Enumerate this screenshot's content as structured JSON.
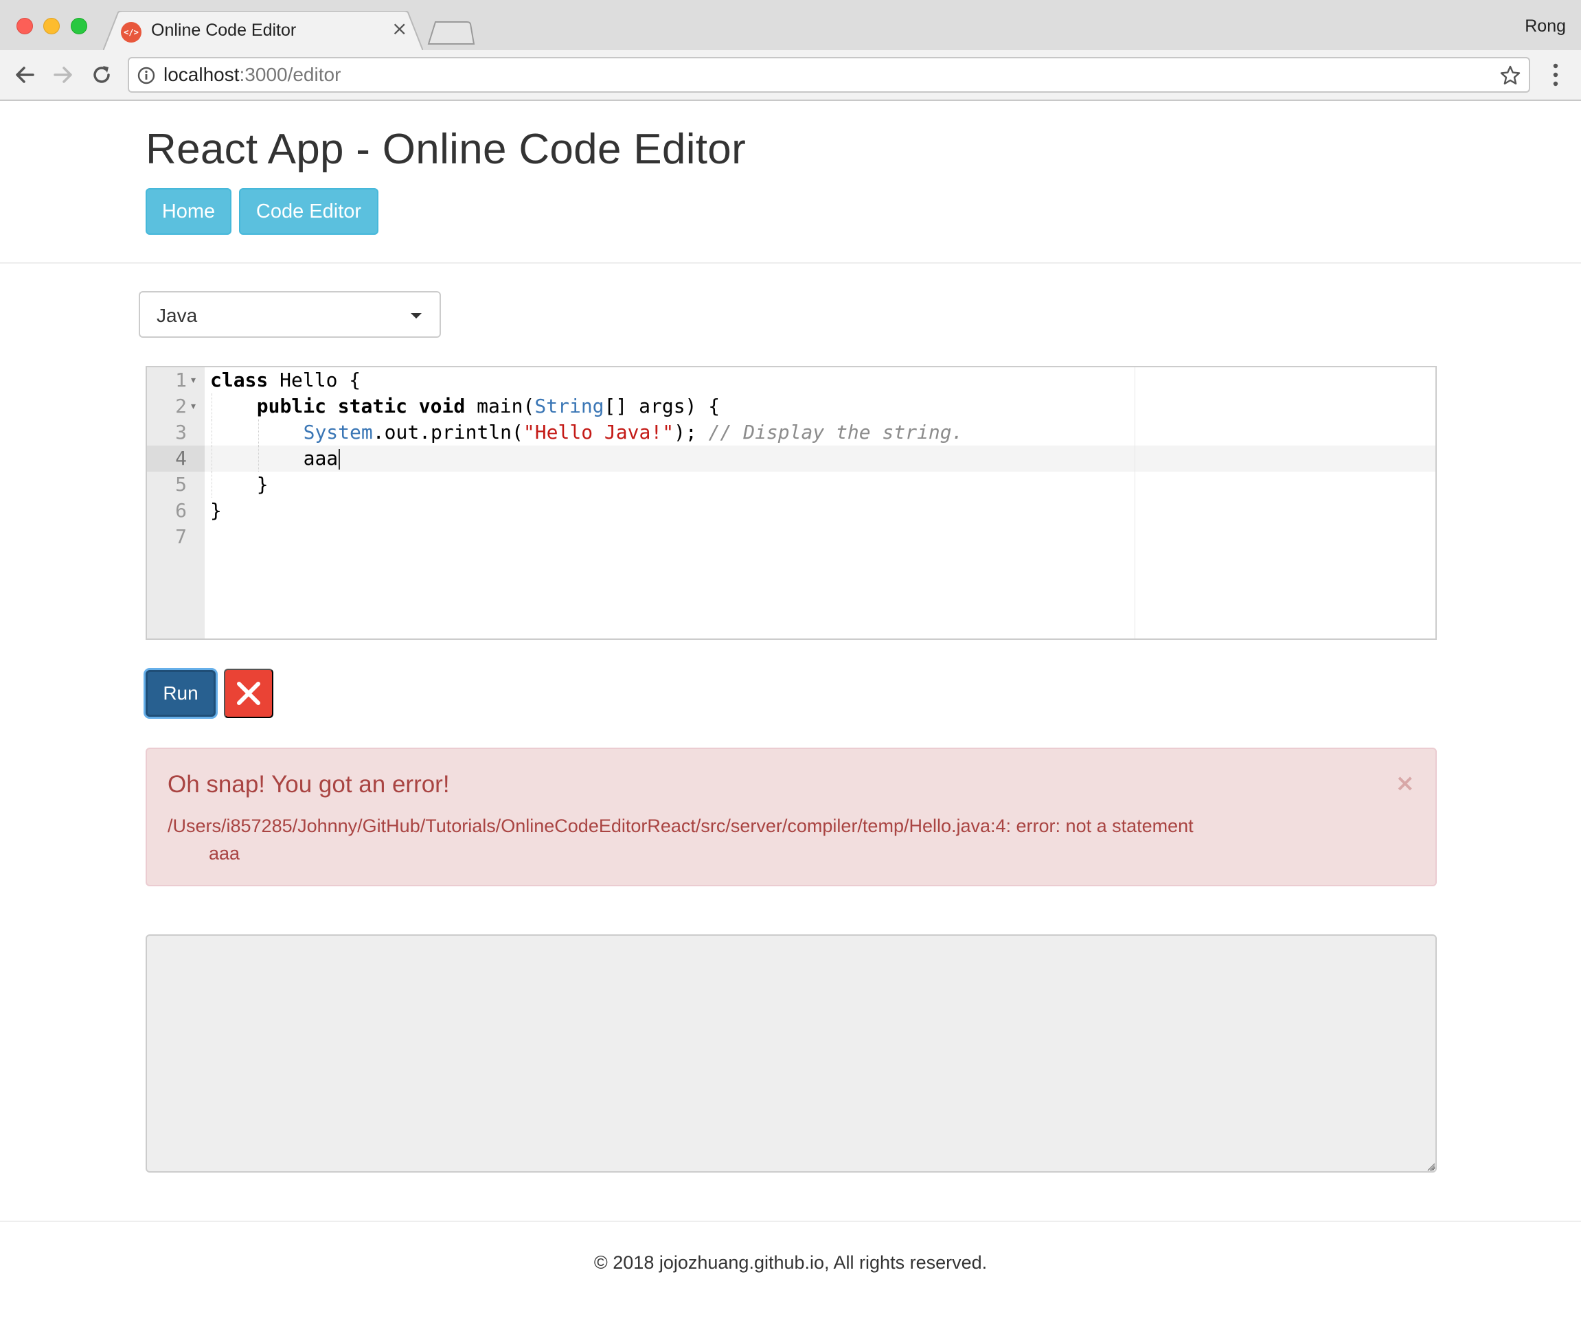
{
  "browser": {
    "tab_title": "Online Code Editor",
    "profile_name": "Rong",
    "url_host": "localhost",
    "url_path": ":3000/editor",
    "icons": [
      "back-icon",
      "forward-icon",
      "reload-icon",
      "info-icon",
      "star-icon",
      "menu-icon",
      "close-icon"
    ]
  },
  "header": {
    "title": "React App - Online Code Editor",
    "nav": {
      "home_label": "Home",
      "editor_label": "Code Editor"
    }
  },
  "language_select": {
    "selected": "Java"
  },
  "editor": {
    "line_numbers": [
      "1",
      "2",
      "3",
      "4",
      "5",
      "6",
      "7"
    ],
    "active_line": 4,
    "lines": [
      {
        "tokens": [
          {
            "kw": "class"
          },
          {
            "text": " Hello {"
          }
        ]
      },
      {
        "tokens": [
          {
            "kw": "public static void"
          },
          {
            "text": " main("
          },
          {
            "type": "String"
          },
          {
            "text": "[] args) {"
          }
        ]
      },
      {
        "tokens": [
          {
            "type": "System"
          },
          {
            "text": ".out.println("
          },
          {
            "str": "\"Hello Java!\""
          },
          {
            "text": "); "
          },
          {
            "comment": "// Display the string."
          }
        ]
      },
      {
        "tokens": [
          {
            "text": "aaa"
          }
        ]
      },
      {
        "tokens": [
          {
            "text": "}"
          }
        ]
      },
      {
        "tokens": [
          {
            "text": "}"
          }
        ]
      },
      {
        "tokens": []
      }
    ]
  },
  "actions": {
    "run_label": "Run"
  },
  "alert": {
    "title": "Oh snap! You got an error!",
    "message_line1": "/Users/i857285/Johnny/GitHub/Tutorials/OnlineCodeEditorReact/src/server/compiler/temp/Hello.java:4: error: not a statement",
    "message_line2": "        aaa",
    "close_glyph": "×"
  },
  "output": {
    "value": ""
  },
  "footer": {
    "text": "© 2018 jojozhuang.github.io, All rights reserved."
  },
  "colors": {
    "nav_pill": "#5bc0de",
    "run_button": "#286090",
    "clear_button": "#ea4335",
    "alert_bg": "#f2dede",
    "alert_text": "#a94442"
  }
}
